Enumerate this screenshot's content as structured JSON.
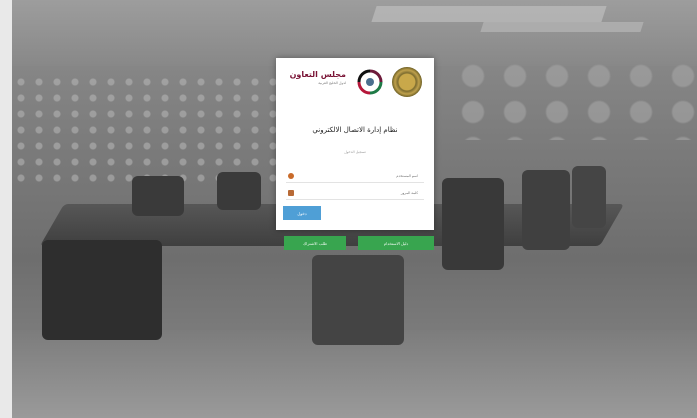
{
  "login": {
    "brand_title": "مجلس التعاون",
    "brand_subtitle": "لدول الخليج العربية",
    "title": "نظام إدارة الاتصال الالكتروني",
    "subtitle": "تسجيل الدخول",
    "username_placeholder": "اسم المستخدم",
    "password_placeholder": "كلمة المرور",
    "login_button": "دخول"
  },
  "actions": {
    "left_button": "طلب الاشتراك",
    "right_button": "دليل الاستخدام"
  },
  "colors": {
    "primary_button": "#4f9fd6",
    "secondary_button": "#38a54f",
    "brand": "#7a1436"
  }
}
